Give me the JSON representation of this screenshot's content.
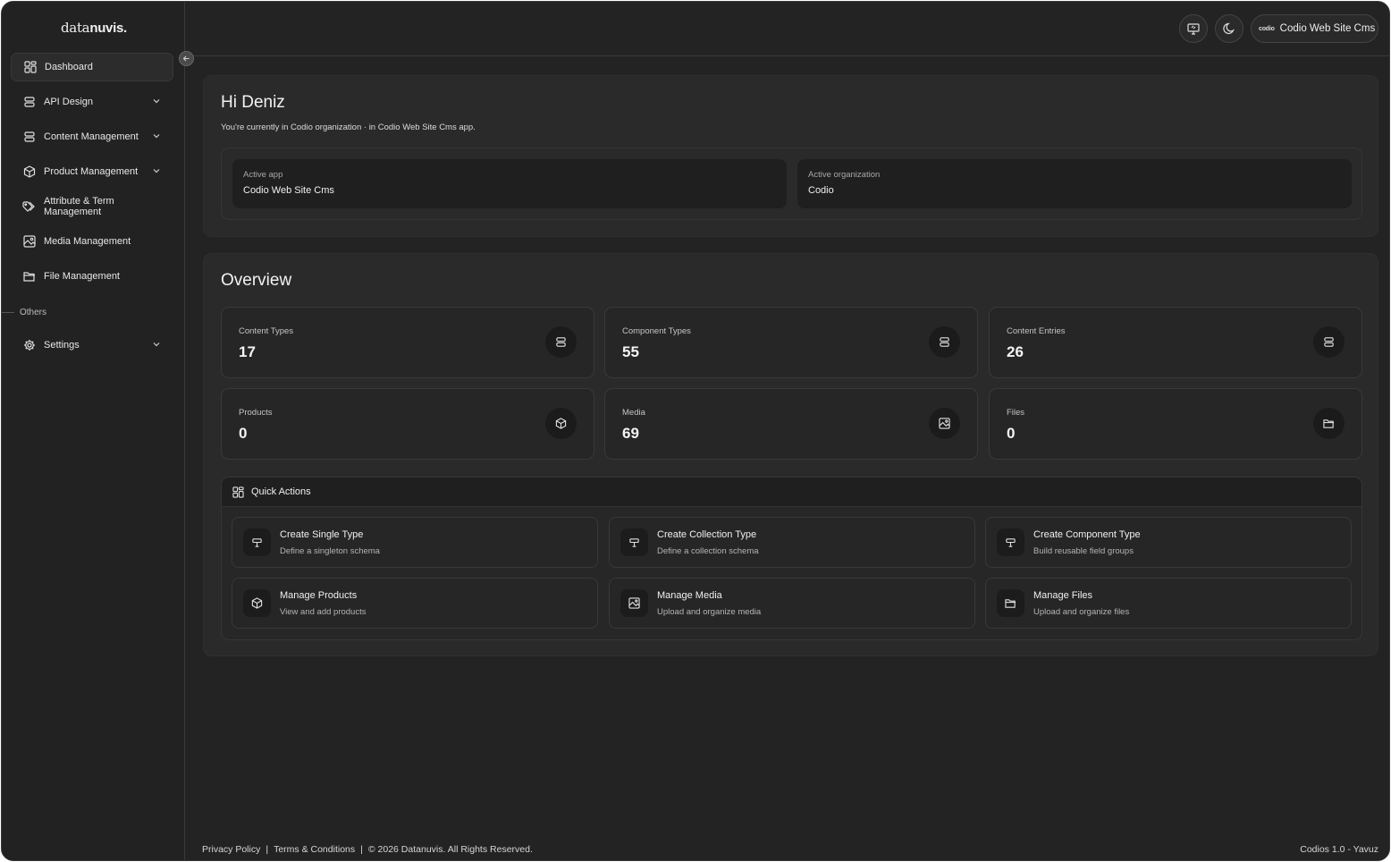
{
  "brand": {
    "logo_light": "data",
    "logo_bold": "nuvis."
  },
  "sidebar": {
    "items": [
      {
        "label": "Dashboard",
        "icon": "grid-icon",
        "active": true
      },
      {
        "label": "API Design",
        "icon": "stack-icon",
        "expandable": true
      },
      {
        "label": "Content Management",
        "icon": "stack-icon",
        "expandable": true
      },
      {
        "label": "Product Management",
        "icon": "box-icon",
        "expandable": true
      },
      {
        "label": "Attribute & Term Management",
        "icon": "tags-icon"
      },
      {
        "label": "Media Management",
        "icon": "image-icon"
      },
      {
        "label": "File Management",
        "icon": "folder-icon"
      }
    ],
    "section_label": "Others",
    "settings_label": "Settings"
  },
  "topbar": {
    "app_brand": "codio",
    "app_name": "Codio Web Site Cms"
  },
  "welcome": {
    "title": "Hi Deniz",
    "subtitle": "You're currently in Codio organization · in Codio Web Site Cms app.",
    "active_app_label": "Active app",
    "active_app_value": "Codio Web Site Cms",
    "active_org_label": "Active organization",
    "active_org_value": "Codio"
  },
  "overview": {
    "title": "Overview",
    "stats": [
      {
        "label": "Content Types",
        "value": "17",
        "icon": "stack-icon"
      },
      {
        "label": "Component Types",
        "value": "55",
        "icon": "stack-icon"
      },
      {
        "label": "Content Entries",
        "value": "26",
        "icon": "stack-icon"
      },
      {
        "label": "Products",
        "value": "0",
        "icon": "box-icon"
      },
      {
        "label": "Media",
        "value": "69",
        "icon": "image-icon"
      },
      {
        "label": "Files",
        "value": "0",
        "icon": "folder-icon"
      }
    ]
  },
  "quick_actions": {
    "title": "Quick Actions",
    "items": [
      {
        "title": "Create Single Type",
        "desc": "Define a singleton schema",
        "icon": "schema-icon"
      },
      {
        "title": "Create Collection Type",
        "desc": "Define a collection schema",
        "icon": "schema-icon"
      },
      {
        "title": "Create Component Type",
        "desc": "Build reusable field groups",
        "icon": "schema-icon"
      },
      {
        "title": "Manage Products",
        "desc": "View and add products",
        "icon": "box-icon"
      },
      {
        "title": "Manage Media",
        "desc": "Upload and organize media",
        "icon": "image-icon"
      },
      {
        "title": "Manage Files",
        "desc": "Upload and organize files",
        "icon": "folder-icon"
      }
    ]
  },
  "footer": {
    "privacy": "Privacy Policy",
    "terms": "Terms & Conditions",
    "copyright": "© 2026 Datanuvis. All Rights Reserved.",
    "version": "Codios 1.0 - Yavuz",
    "separator": "|"
  }
}
